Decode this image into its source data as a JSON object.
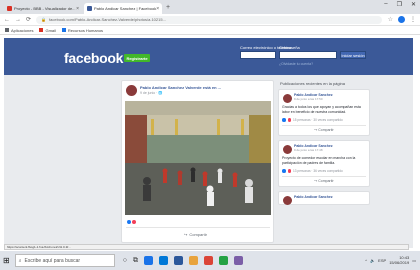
{
  "browser": {
    "tabs": [
      {
        "label": "Proyecto - BBB - Visualizador de...",
        "active": false
      },
      {
        "label": "Pablo Andicar Sanchez | Facebook",
        "active": true
      }
    ],
    "new_tab": "+",
    "window_controls": {
      "minimize": "–",
      "restore": "❐",
      "close": "✕"
    },
    "url": "facebook.com/Pablo-Andicar-Sanchez-Valverde/photos/a.10215...",
    "bookmarks": [
      "Aplicaciones",
      "Gmail",
      "Recursos Humanos"
    ]
  },
  "facebook_header": {
    "logo": "facebook",
    "register_button": "Registrarte",
    "email_label": "Correo electrónico o teléfono",
    "password_label": "Contraseña",
    "login_button": "Iniciar sesión",
    "forgot_link": "¿Olvidaste tu cuenta?"
  },
  "post": {
    "author": "Pablo Andicar Sanchez Valverde está en ...",
    "date": "9 de junio · 🌐",
    "share_label": "Compartir"
  },
  "sidebar": {
    "heading": "Publicaciones recientes en la página",
    "cards": [
      {
        "name": "Pablo Andicar Sanchez",
        "date": "9 de junio a las 17:50",
        "text": "Gracias a todos los que apoyan y acompañan esta labor en beneficio de nuestra comunidad.",
        "stats": "15 personas · 30 veces compartido",
        "share": "Compartir"
      },
      {
        "name": "Pablo Andicar Sanchez",
        "date": "9 de junio a las 17:48",
        "text": "Proyecto de comedor escolar en marcha con la participación de padres de familia.",
        "stats": "13 personas · 36 veces compartido",
        "share": "Compartir"
      },
      {
        "name": "Pablo Andicar Sanchez",
        "date": "",
        "text": "",
        "stats": "",
        "share": ""
      }
    ]
  },
  "status_url": "https://scontent.fbog1-1.fna.fbcdn.net/v/t1.0-9/...",
  "taskbar": {
    "search_placeholder": "Escribe aquí para buscar",
    "time": "10:43",
    "date": "15/06/2019",
    "lang": "ESP"
  }
}
